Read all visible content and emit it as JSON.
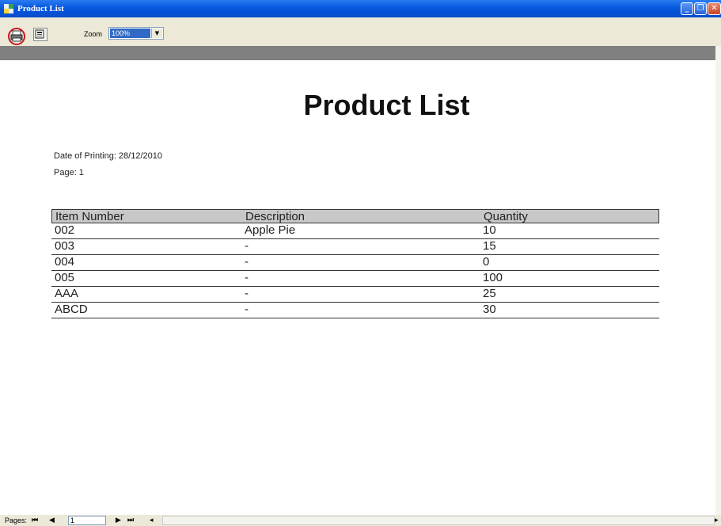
{
  "window": {
    "title": "Product List"
  },
  "toolbar": {
    "zoom_label": "Zoom",
    "zoom_value": "100%"
  },
  "report": {
    "title": "Product List",
    "date_line": "Date of Printing: 28/12/2010",
    "page_line": "Page: 1",
    "columns": [
      "Item Number",
      "Description",
      "Quantity"
    ],
    "rows": [
      [
        "002",
        "Apple Pie",
        "10"
      ],
      [
        "003",
        "-",
        "15"
      ],
      [
        "004",
        "-",
        "0"
      ],
      [
        "005",
        "-",
        "100"
      ],
      [
        "AAA",
        "-",
        "25"
      ],
      [
        "ABCD",
        "-",
        "30"
      ]
    ]
  },
  "pager": {
    "label": "Pages:",
    "current_page": "1"
  },
  "icons": {
    "app": "app-icon",
    "print": "printer-icon",
    "export": "export-icon",
    "first": "first-page-icon",
    "prev": "prev-page-icon",
    "next": "next-page-icon",
    "last": "last-page-icon"
  },
  "colors": {
    "titlebar": "#0a5be0",
    "highlight": "#316ac5",
    "print_ring": "#c8141a",
    "header_row": "#c8c8c8"
  }
}
